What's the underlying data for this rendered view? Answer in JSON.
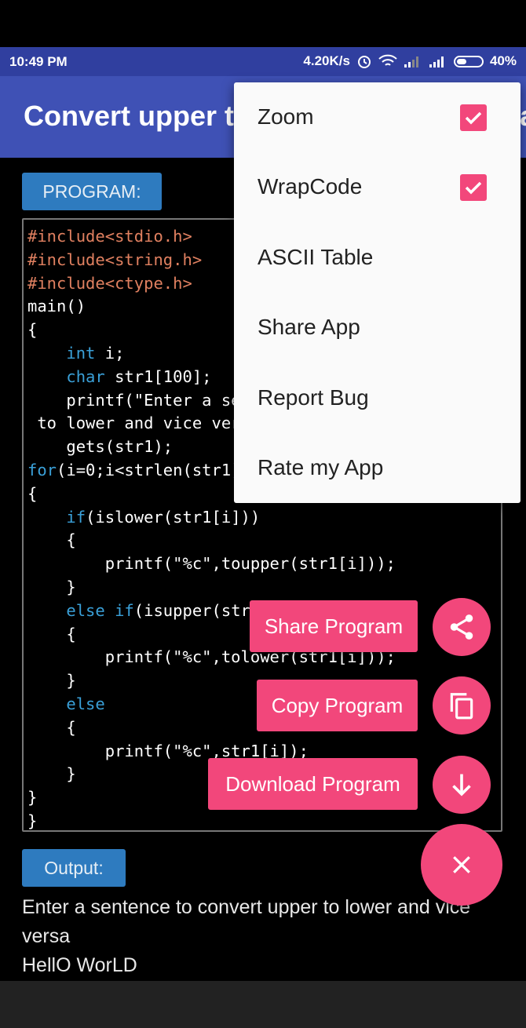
{
  "status_bar": {
    "time": "10:49 PM",
    "speed": "4.20K/s",
    "battery": "40%"
  },
  "app_bar": {
    "title": "Convert upper to lower and vice versa"
  },
  "program_label": "PROGRAM:",
  "code": {
    "line1": "#include<stdio.h>",
    "line2": "#include<string.h>",
    "line3": "#include<ctype.h>",
    "line4": "main()",
    "line5": "{",
    "line6_kw": "int",
    "line6_rest": " i;",
    "line7_kw": "char",
    "line7_rest": " str1[100];",
    "line8": "    printf(\"Enter a sentence to convert upper",
    "line9": " to lower and vice versa\\n\");",
    "line10": "    gets(str1);",
    "line11_kw": "for",
    "line11_rest": "(i=0;i<strlen(str1);i++)",
    "line12": "{",
    "line13_kw": "if",
    "line13_rest": "(islower(str1[i]))",
    "line14": "    {",
    "line15": "        printf(\"%c\",toupper(str1[i]));",
    "line16": "    }",
    "line17_kw1": "else",
    "line17_kw2": "if",
    "line17_rest": "(isupper(str1[i]))",
    "line18": "    {",
    "line19": "        printf(\"%c\",tolower(str1[i]));",
    "line20": "    }",
    "line21_kw": "else",
    "line22": "    {",
    "line23": "        printf(\"%c\",str1[i]);",
    "line24": "    }",
    "line25": "}",
    "line26": "}"
  },
  "output_label": "Output:",
  "output_text": {
    "line1": "Enter a sentence to convert upper to lower and vice",
    "line2": "versa",
    "line3": "HellO WorLD"
  },
  "menu": {
    "items": [
      {
        "label": "Zoom",
        "checked": true
      },
      {
        "label": "WrapCode",
        "checked": true
      },
      {
        "label": "ASCII Table"
      },
      {
        "label": "Share App"
      },
      {
        "label": "Report Bug"
      },
      {
        "label": "Rate my App"
      }
    ]
  },
  "fab_actions": {
    "share": "Share Program",
    "copy": "Copy Program",
    "download": "Download Program"
  },
  "colors": {
    "accent": "#f2477b",
    "primary": "#3f51b5",
    "primary_dark": "#303f9f",
    "label_blue": "#2e7bbf"
  },
  "icons": {
    "share": "share-icon",
    "copy": "copy-icon",
    "download": "arrow-down-icon",
    "close": "close-icon"
  }
}
